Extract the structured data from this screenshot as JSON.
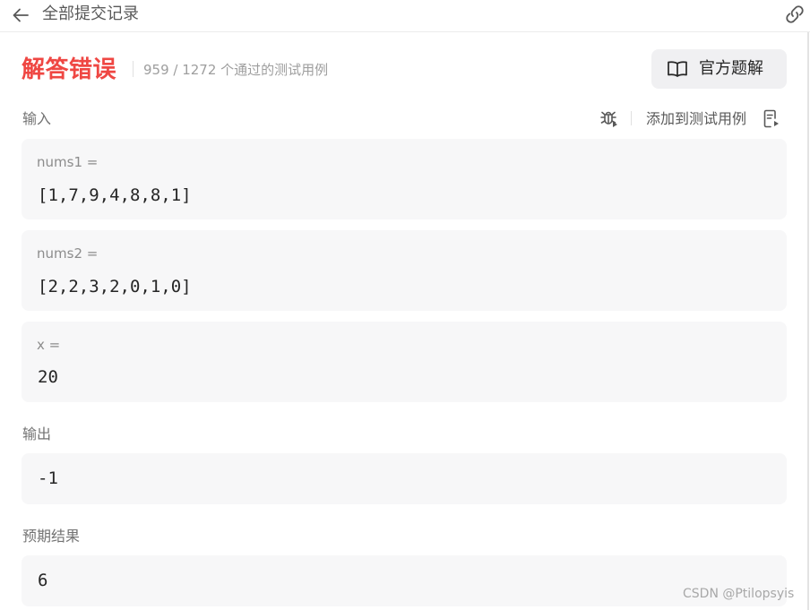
{
  "header": {
    "title": "全部提交记录",
    "back_icon": "arrow-left-icon",
    "link_icon": "link-icon"
  },
  "result": {
    "status": "解答错误",
    "stats": "959 / 1272 个通过的测试用例",
    "status_color": "#ef4743"
  },
  "solution_button": {
    "label": "官方题解",
    "icon": "book-open-icon"
  },
  "input_section": {
    "label": "输入",
    "add_test_label": "添加到测试用例",
    "debug_icon": "bug-icon",
    "add_icon": "add-file-icon",
    "params": [
      {
        "name": "nums1 =",
        "value": "[1,7,9,4,8,8,1]"
      },
      {
        "name": "nums2 =",
        "value": "[2,2,3,2,0,1,0]"
      },
      {
        "name": "x =",
        "value": "20"
      }
    ]
  },
  "output_section": {
    "label": "输出",
    "value": "-1"
  },
  "expected_section": {
    "label": "预期结果",
    "value": "6"
  },
  "watermark": "CSDN @Ptilopsyis"
}
